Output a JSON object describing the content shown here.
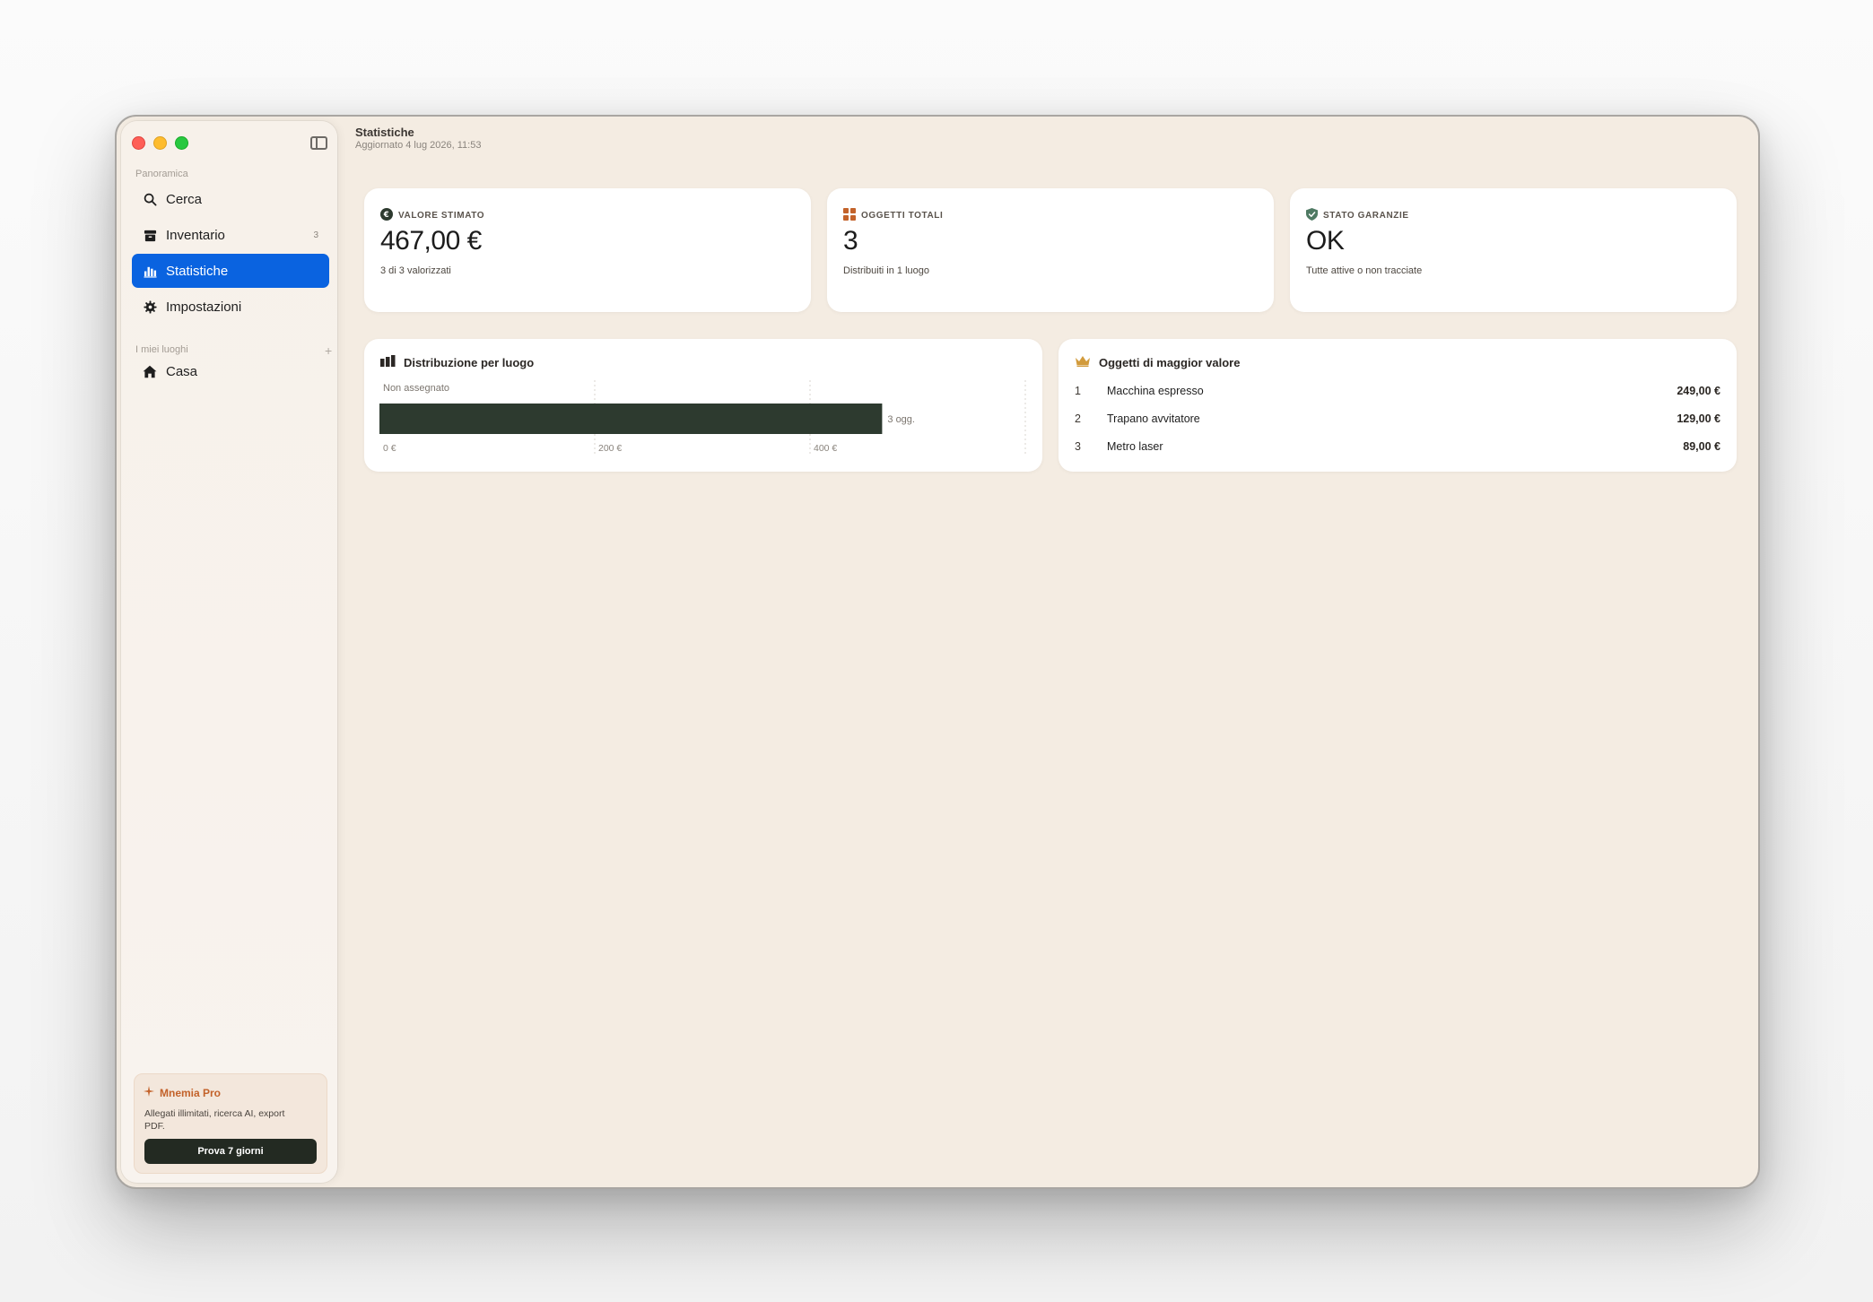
{
  "sidebar": {
    "section_overview": "Panoramica",
    "items": [
      {
        "label": "Cerca",
        "icon": "search-icon"
      },
      {
        "label": "Inventario",
        "icon": "archive-icon",
        "badge": "3"
      },
      {
        "label": "Statistiche",
        "icon": "bar-chart-icon",
        "active": true
      },
      {
        "label": "Impostazioni",
        "icon": "gear-icon"
      }
    ],
    "section_places": "I miei luoghi",
    "places": [
      {
        "label": "Casa",
        "icon": "house-icon"
      }
    ],
    "pro": {
      "title": "Mnemia Pro",
      "description": "Allegati illimitati, ricerca AI, export PDF.",
      "button": "Prova 7 giorni"
    }
  },
  "header": {
    "title": "Statistiche",
    "subtitle": "Aggiornato 4 lug 2026, 11:53"
  },
  "stats": [
    {
      "label": "VALORE STIMATO",
      "value": "467,00 €",
      "footnote": "3 di 3 valorizzati",
      "icon": "euro-icon"
    },
    {
      "label": "OGGETTI TOTALI",
      "value": "3",
      "footnote": "Distribuiti in 1 luogo",
      "icon": "grid-icon"
    },
    {
      "label": "STATO GARANZIE",
      "value": "OK",
      "footnote": "Tutte attive o non tracciate",
      "icon": "shield-check-icon"
    }
  ],
  "distribution": {
    "title": "Distribuzione per luogo"
  },
  "top_items": {
    "title": "Oggetti di maggior valore",
    "rows": [
      {
        "rank": "1",
        "name": "Macchina espresso",
        "value": "249,00 €"
      },
      {
        "rank": "2",
        "name": "Trapano avvitatore",
        "value": "129,00 €"
      },
      {
        "rank": "3",
        "name": "Metro laser",
        "value": "89,00 €"
      }
    ]
  },
  "colors": {
    "accent": "#0a63e0",
    "bar": "#2d3a2f",
    "pro_accent": "#c3622a",
    "crown": "#d29b3c"
  },
  "chart_data": {
    "type": "bar",
    "orientation": "horizontal",
    "categories": [
      "Non assegnato"
    ],
    "values": [
      467
    ],
    "data_labels": [
      "3 ogg."
    ],
    "ticks": [
      0,
      200,
      400
    ],
    "tick_labels": [
      "0 €",
      "200 €",
      "400 €"
    ],
    "xlim": [
      0,
      600
    ],
    "grid": true
  }
}
